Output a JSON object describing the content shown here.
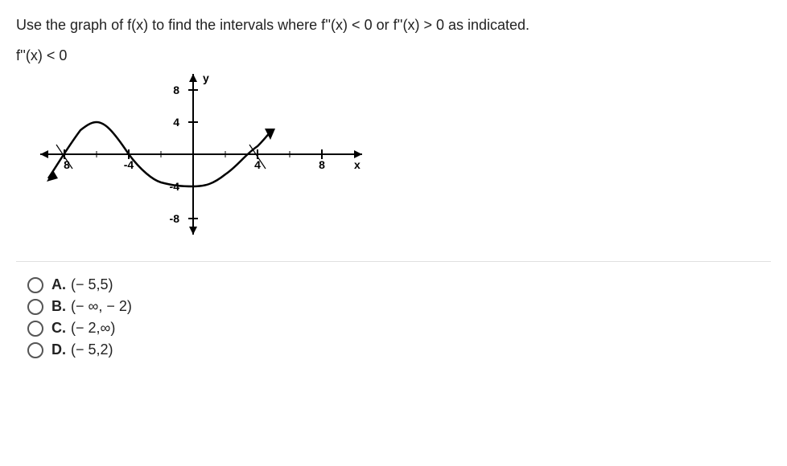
{
  "question": "Use the graph of f(x) to find the intervals where f''(x) < 0 or f''(x) > 0 as indicated.",
  "condition": "f''(x) < 0",
  "axis": {
    "y_label": "y",
    "x_label": "x",
    "y_ticks": {
      "pos8": "8",
      "pos4": "4",
      "neg4": "-4",
      "neg8": "-8"
    },
    "x_ticks": {
      "neg8": "8",
      "neg4": "-4",
      "pos4": "4",
      "pos8": "8"
    }
  },
  "chart_data": {
    "type": "line",
    "title": "",
    "xlabel": "x",
    "ylabel": "y",
    "xlim": [
      -10,
      10
    ],
    "ylim": [
      -10,
      10
    ],
    "series": [
      {
        "name": "f(x)",
        "x": [
          -9,
          -8,
          -7,
          -6,
          -5,
          -4,
          -3,
          -2,
          -1,
          0,
          1,
          2,
          3,
          4,
          5
        ],
        "y": [
          -3,
          -1,
          3,
          4,
          3,
          0,
          -2,
          -3.5,
          -4,
          -4,
          -3.5,
          -2.5,
          -1,
          1,
          3
        ]
      }
    ]
  },
  "options": {
    "A": {
      "letter": "A.",
      "text": "(− 5,5)"
    },
    "B": {
      "letter": "B.",
      "text": "(− ∞, − 2)"
    },
    "C": {
      "letter": "C.",
      "text": "(− 2,∞)"
    },
    "D": {
      "letter": "D.",
      "text": "(− 5,2)"
    }
  }
}
